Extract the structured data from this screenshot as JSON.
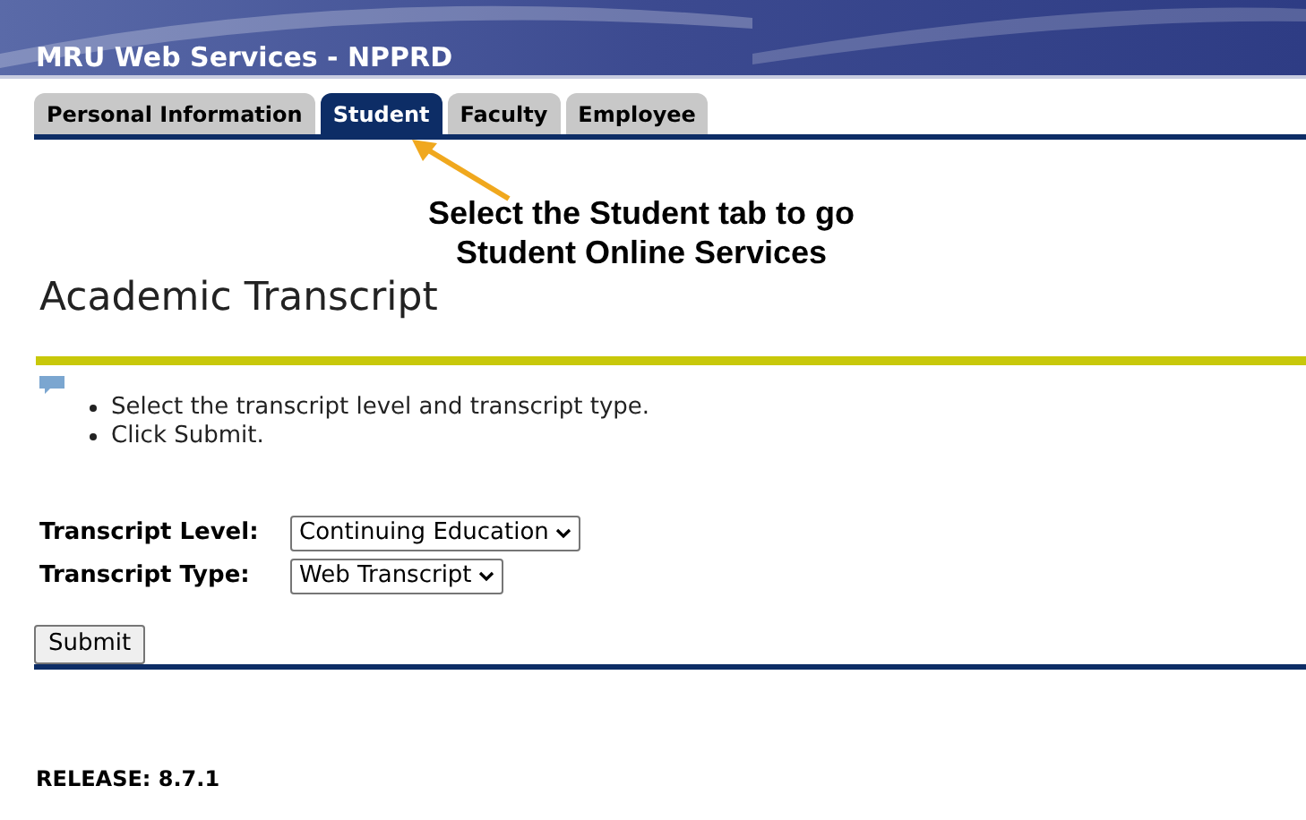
{
  "header": {
    "title": "MRU Web Services - NPPRD"
  },
  "tabs": [
    {
      "label": "Personal Information",
      "selected": false
    },
    {
      "label": "Student",
      "selected": true
    },
    {
      "label": "Faculty",
      "selected": false
    },
    {
      "label": "Employee",
      "selected": false
    }
  ],
  "annotation": {
    "lines": [
      "Select the Student tab to go",
      "Student Online Services"
    ]
  },
  "page_title": "Academic Transcript",
  "instructions": [
    "Select the transcript level and transcript type.",
    "Click Submit."
  ],
  "fields": [
    {
      "label": "Transcript Level:",
      "value": "Continuing Education"
    },
    {
      "label": "Transcript Type:",
      "value": "Web Transcript"
    }
  ],
  "submit": "Submit",
  "release": "RELEASE: 8.7.1"
}
